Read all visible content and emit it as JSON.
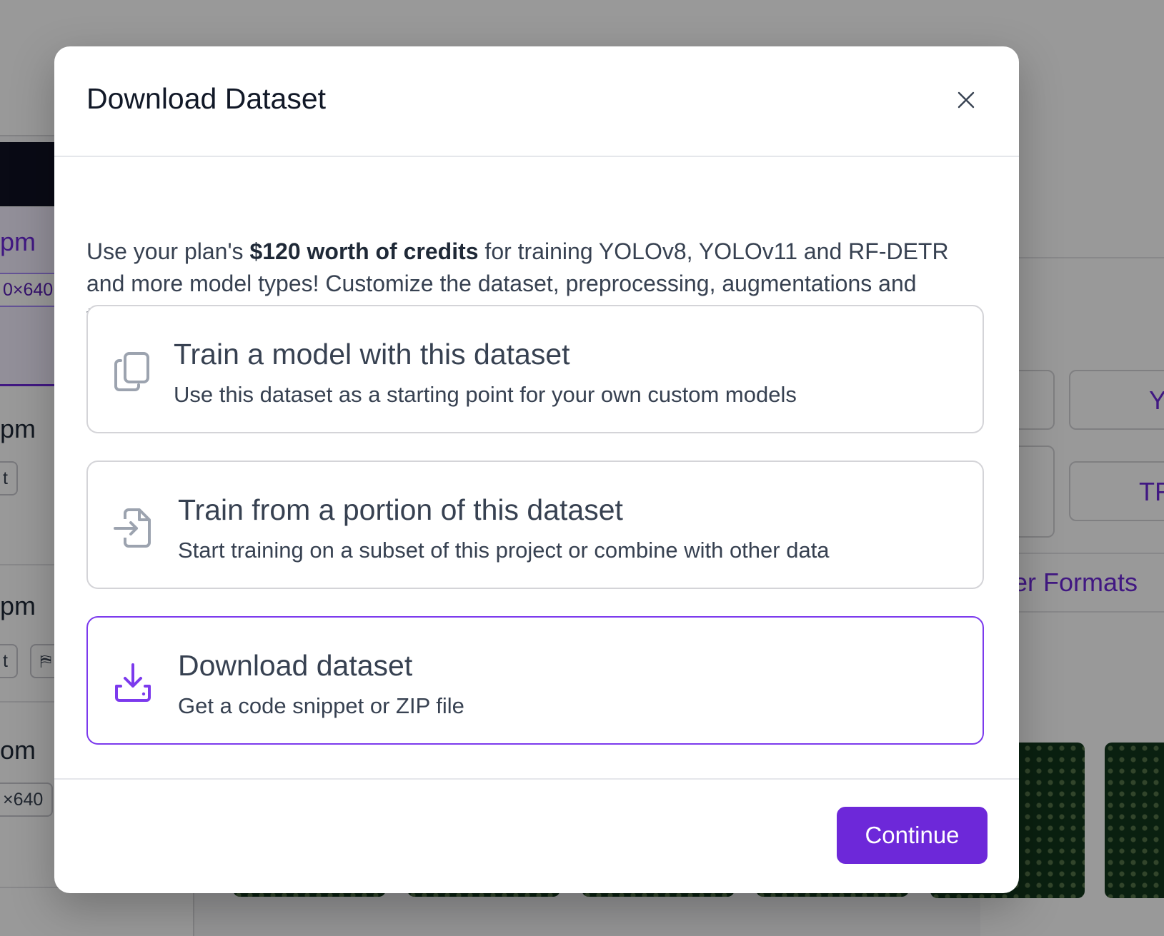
{
  "background": {
    "versions": [
      {
        "time": "pm",
        "chip": "0×640"
      },
      {
        "time": "pm",
        "chip": "t"
      },
      {
        "time": "pm",
        "chip": "t",
        "chip2": "⛿"
      },
      {
        "time": "om",
        "chip": "×640"
      }
    ],
    "format_buttons": [
      "Y",
      "TF"
    ],
    "other_formats_link": "er Formats"
  },
  "modal": {
    "title": "Download Dataset",
    "intro_before": "Use your plan's ",
    "intro_bold": "$120 worth of credits",
    "intro_after": " for training YOLOv8, YOLOv11 and RF-DETR and more model types! Customize the dataset, preprocessing, augmentations and training.",
    "options": [
      {
        "icon": "copy-icon",
        "title": "Train a model with this dataset",
        "description": "Use this dataset as a starting point for your own custom models",
        "selected": false
      },
      {
        "icon": "file-import-icon",
        "title": "Train from a portion of this dataset",
        "description": "Start training on a subset of this project or combine with other data",
        "selected": false
      },
      {
        "icon": "download-tray-icon",
        "title": "Download dataset",
        "description": "Get a code snippet or ZIP file",
        "selected": true
      }
    ],
    "continue_label": "Continue",
    "close_icon": "close-icon"
  },
  "colors": {
    "accent": "#6d28d9",
    "selected_border": "#7c3aed",
    "icon_gray": "#9ca3af",
    "overlay": "rgba(0,0,0,0.40)"
  }
}
